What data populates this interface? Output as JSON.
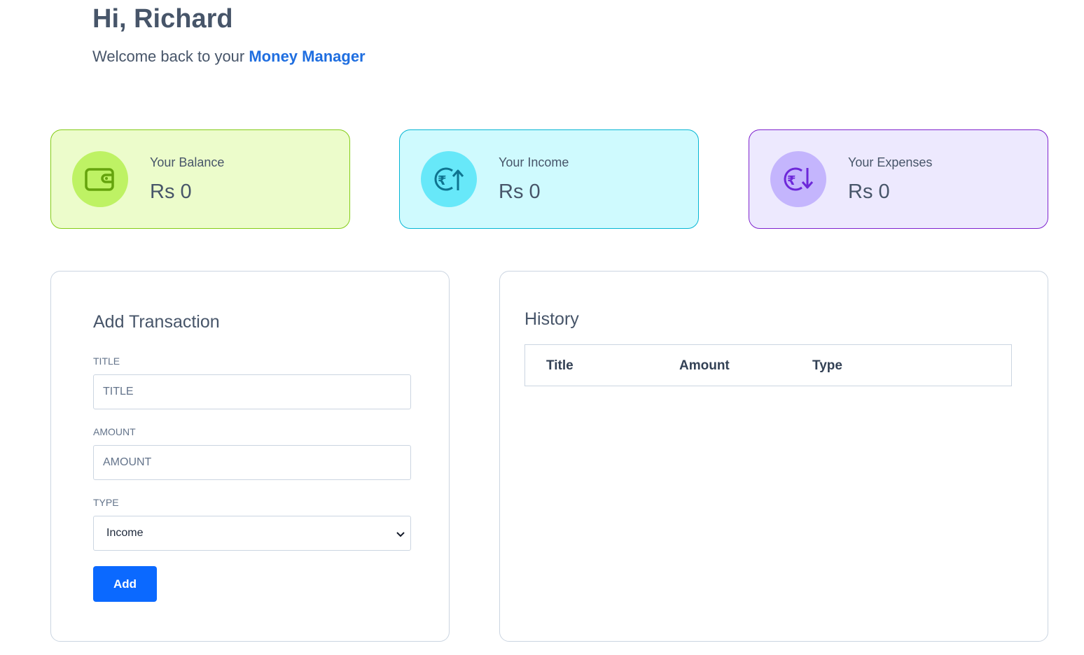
{
  "header": {
    "greeting": "Hi, Richard",
    "welcome_prefix": "Welcome back to your ",
    "brand": "Money Manager"
  },
  "cards": {
    "balance": {
      "label": "Your Balance",
      "amount": "Rs 0",
      "icon": "wallet-icon",
      "color": "#84cc16"
    },
    "income": {
      "label": "Your Income",
      "amount": "Rs 0",
      "icon": "rupee-up-icon",
      "color": "#0e9fb8"
    },
    "expenses": {
      "label": "Your Expenses",
      "amount": "Rs 0",
      "icon": "rupee-down-icon",
      "color": "#7c3aed"
    }
  },
  "add_transaction": {
    "title": "Add Transaction",
    "title_label": "TITLE",
    "title_placeholder": "TITLE",
    "amount_label": "AMOUNT",
    "amount_placeholder": "AMOUNT",
    "type_label": "TYPE",
    "type_selected": "Income",
    "add_button": "Add",
    "accent": "#0b69ff"
  },
  "history": {
    "title": "History",
    "columns": [
      "Title",
      "Amount",
      "Type"
    ]
  }
}
